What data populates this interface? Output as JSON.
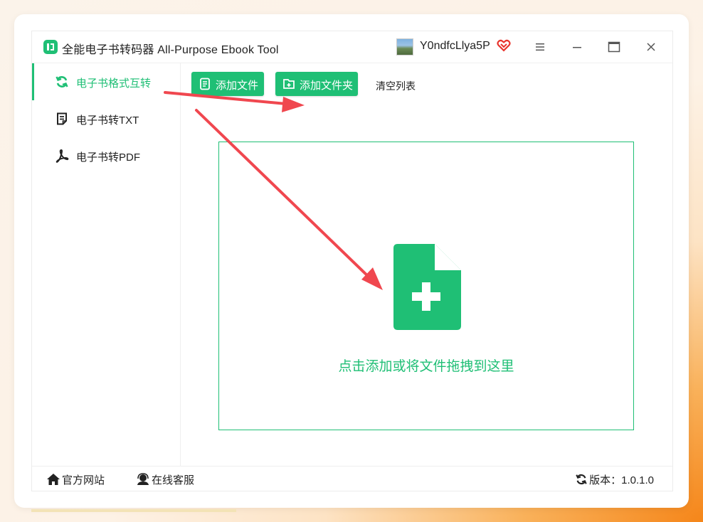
{
  "window": {
    "title": "全能电子书转码器 All-Purpose Ebook Tool",
    "username": "Y0ndfcLlya5P",
    "icons": [
      "app-logo-icon",
      "avatar",
      "vip-heart-icon",
      "menu-icon",
      "minimize-icon",
      "maximize-icon",
      "close-icon"
    ]
  },
  "sidebar": {
    "items": [
      {
        "label": "电子书格式互转",
        "icon": "refresh-icon",
        "active": true
      },
      {
        "label": "电子书转TXT",
        "icon": "text-document-icon",
        "active": false
      },
      {
        "label": "电子书转PDF",
        "icon": "pdf-icon",
        "active": false
      }
    ]
  },
  "toolbar": {
    "add_file": "添加文件",
    "add_folder": "添加文件夹",
    "clear_list": "清空列表"
  },
  "dropzone": {
    "text": "点击添加或将文件拖拽到这里",
    "icon": "file-add-icon"
  },
  "footer": {
    "website": "官方网站",
    "support": "在线客服",
    "version": "版本：1.0.1.0"
  },
  "colors": {
    "accent": "#1fbf75",
    "arrow": "#f0474f",
    "vip": "#e8342d"
  }
}
